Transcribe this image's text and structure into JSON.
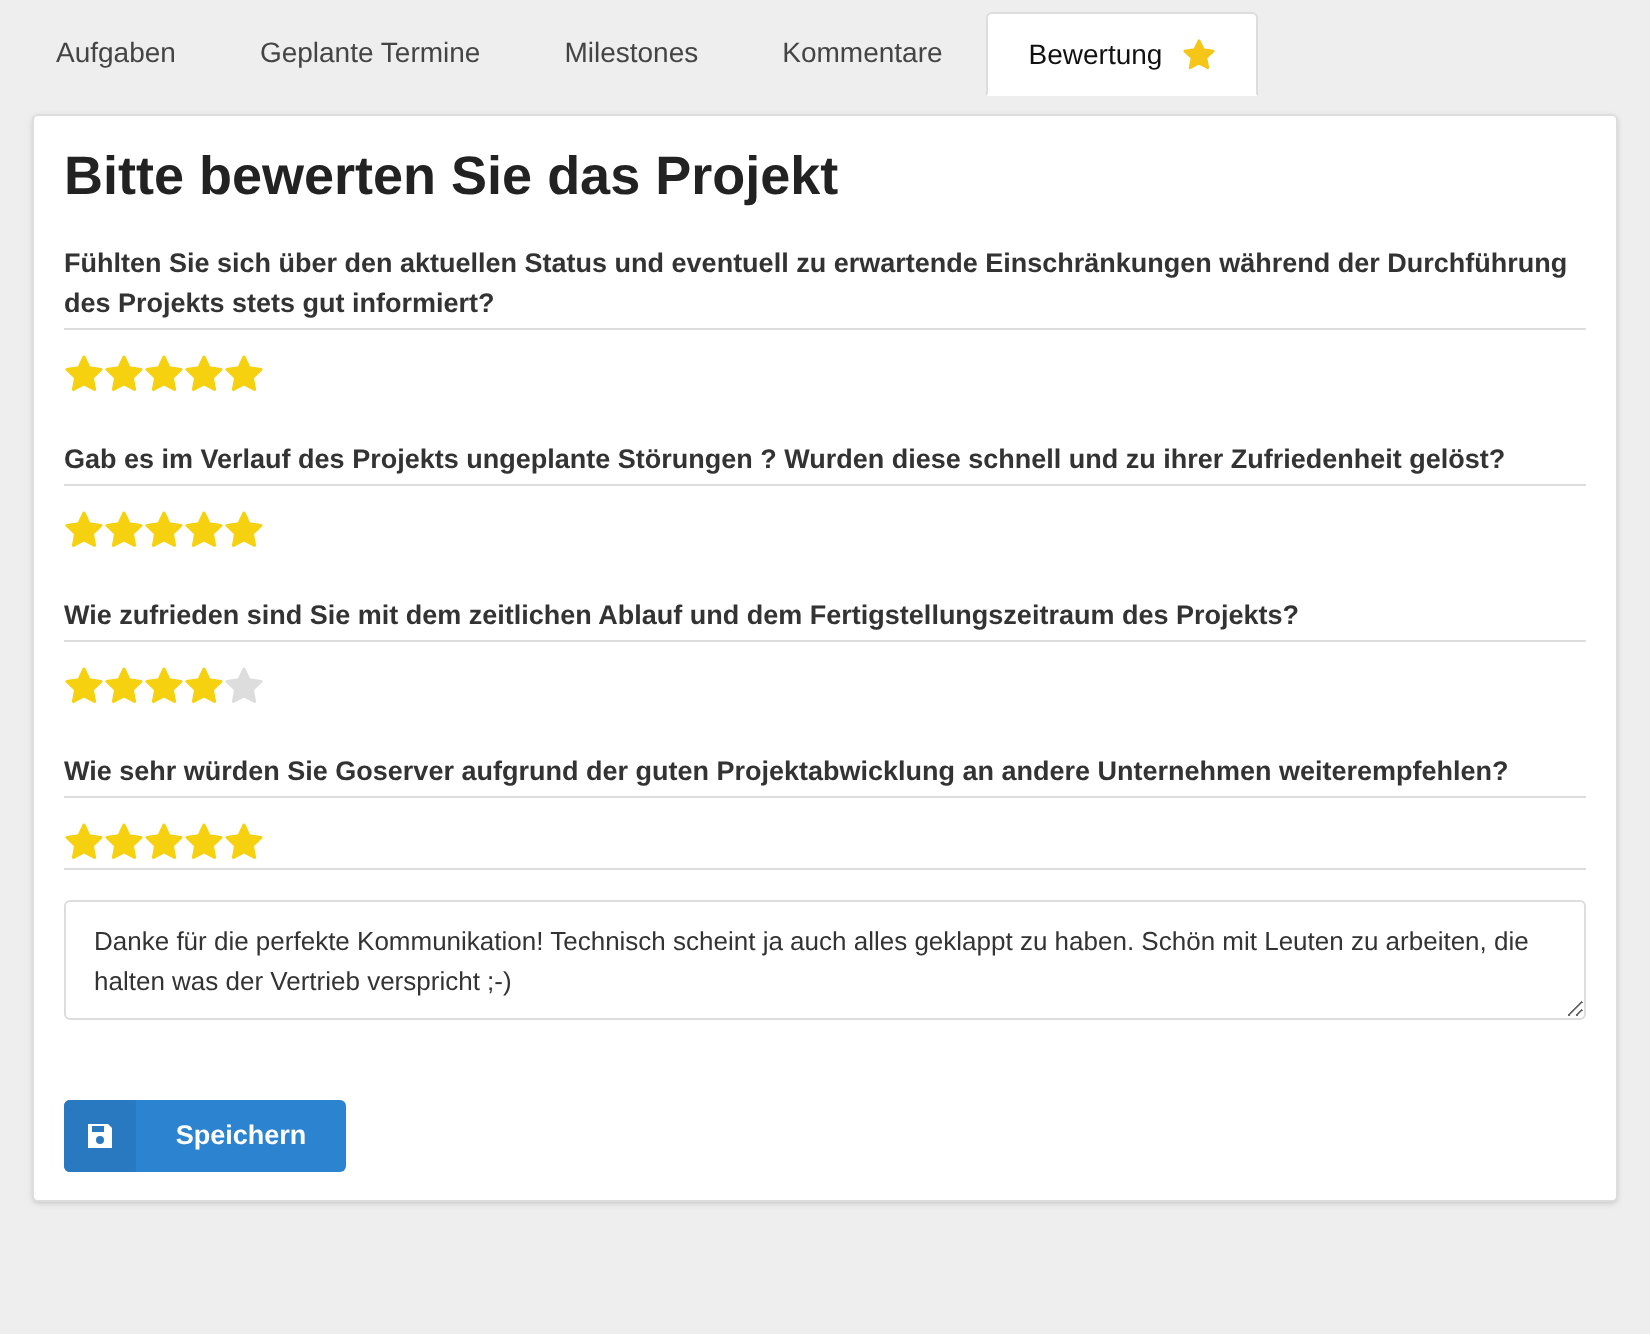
{
  "tabs": [
    {
      "label": "Aufgaben",
      "selected": false,
      "icon": false
    },
    {
      "label": "Geplante Termine",
      "selected": false,
      "icon": false
    },
    {
      "label": "Milestones",
      "selected": false,
      "icon": false
    },
    {
      "label": "Kommentare",
      "selected": false,
      "icon": false
    },
    {
      "label": "Bewertung",
      "selected": true,
      "icon": true
    }
  ],
  "title": "Bitte bewerten Sie das Projekt",
  "questions": [
    {
      "text": "Fühlten Sie sich über den aktuellen Status und eventuell zu erwartende Einschränkungen während der Durchführung des Projekts stets gut informiert?",
      "stars": 5
    },
    {
      "text": "Gab es im Verlauf des Projekts ungeplante Störungen ? Wurden diese schnell und zu ihrer Zufriedenheit gelöst?",
      "stars": 5
    },
    {
      "text": "Wie zufrieden sind Sie mit dem zeitlichen Ablauf und dem Fertigstellungszeitraum des Projekts?",
      "stars": 4
    },
    {
      "text": "Wie sehr würden Sie Goserver aufgrund der guten Projektabwicklung an andere Unternehmen weiterempfehlen?",
      "stars": 5
    }
  ],
  "comment": {
    "value": "Danke für die perfekte Kommunikation! Technisch scheint ja auch alles geklappt zu haben. Schön mit Leuten zu arbeiten, die halten was der Vertrieb verspricht ;-)"
  },
  "save_button": {
    "label": "Speichern"
  }
}
